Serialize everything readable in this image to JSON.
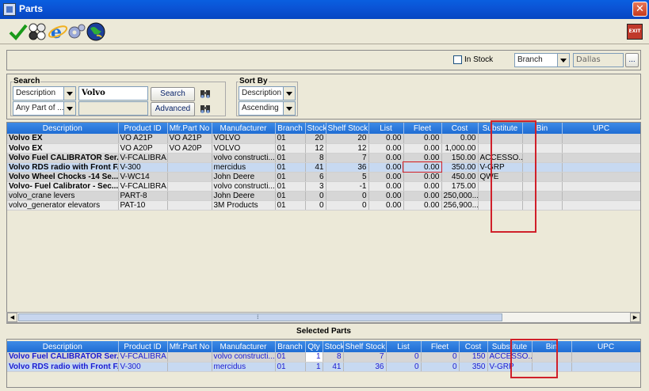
{
  "window": {
    "title": "Parts",
    "close_glyph": "✕"
  },
  "toolbar": {
    "icons": [
      "checkmark-icon",
      "parts-balls-icon",
      "internet-explorer-icon",
      "gears-icon",
      "globe-icon"
    ],
    "exit_label": "EXIT"
  },
  "filter": {
    "in_stock_label": "In Stock",
    "in_stock_checked": false,
    "branch_mode": "Branch",
    "branch_value": "Dallas",
    "browse_label": "..."
  },
  "search": {
    "group_title": "Search",
    "field_select": "Description",
    "query": "Volvo",
    "match_select": "Any Part of ...",
    "search_button": "Search",
    "advanced_button": "Advanced"
  },
  "sort": {
    "group_title": "Sort By",
    "field": "Description",
    "order": "Ascending"
  },
  "parts_table": {
    "columns": [
      "Description",
      "Product ID",
      "Mfr.Part No",
      "Manufacturer",
      "Branch",
      "Stock",
      "Shelf Stock",
      "List",
      "Fleet",
      "Cost",
      "Substitute",
      "Bin",
      "UPC"
    ],
    "rows": [
      [
        "Volvo EX",
        "VO A21P",
        "VO A21P",
        "VOLVO",
        "01",
        "20",
        "20",
        "0.00",
        "0.00",
        "0.00",
        "",
        "",
        ""
      ],
      [
        "Volvo EX",
        "VO A20P",
        "VO A20P",
        "VOLVO",
        "01",
        "12",
        "12",
        "0.00",
        "0.00",
        "1,000.00",
        "",
        "",
        ""
      ],
      [
        "Volvo Fuel CALIBRATOR Ser...",
        "V-FCALIBRA...",
        "",
        "volvo constructi...",
        "01",
        "8",
        "7",
        "0.00",
        "0.00",
        "150.00",
        "ACCESSO...",
        "",
        ""
      ],
      [
        "Volvo RDS radio with Front F...",
        "V-300",
        "",
        "mercidus",
        "01",
        "41",
        "36",
        "0.00",
        "0.00",
        "350.00",
        "V-GRP",
        "",
        ""
      ],
      [
        "Volvo Wheel Chocks -14 Se...",
        "V-WC14",
        "",
        "John Deere",
        "01",
        "6",
        "5",
        "0.00",
        "0.00",
        "450.00",
        "QWE",
        "",
        ""
      ],
      [
        "Volvo- Fuel Calibrator - Sec...",
        "V-FCALIBRA...",
        "",
        "volvo constructi...",
        "01",
        "3",
        "-1",
        "0.00",
        "0.00",
        "175.00",
        "",
        "",
        ""
      ],
      [
        "volvo_crane levers",
        "PART-8",
        "",
        "John Deere",
        "01",
        "0",
        "0",
        "0.00",
        "0.00",
        "250,000...",
        "",
        "",
        ""
      ],
      [
        "volvo_generator elevators",
        "PAT-10",
        "",
        "3M Products",
        "01",
        "0",
        "0",
        "0.00",
        "0.00",
        "256,900...",
        "",
        "",
        ""
      ]
    ],
    "bold_rows": [
      0,
      1,
      2,
      3,
      4,
      5
    ],
    "selected_row": 3
  },
  "selected": {
    "title": "Selected Parts",
    "columns": [
      "Description",
      "Product ID",
      "Mfr.Part No",
      "Manufacturer",
      "Branch",
      "Qty",
      "Stock",
      "Shelf Stock",
      "List",
      "Fleet",
      "Cost",
      "Substitute",
      "Bin",
      "UPC"
    ],
    "rows": [
      [
        "Volvo Fuel CALIBRATOR Ser...",
        "V-FCALIBRA...",
        "",
        "volvo constructi...",
        "01",
        "1",
        "8",
        "7",
        "0",
        "0",
        "150",
        "ACCESSO...",
        "",
        ""
      ],
      [
        "Volvo RDS radio with Front F...",
        "V-300",
        "",
        "mercidus",
        "01",
        "1",
        "41",
        "36",
        "0",
        "0",
        "350",
        "V-GRP",
        "",
        ""
      ]
    ]
  },
  "scroll": {
    "left": "◀",
    "right": "▶",
    "grip": "⁞"
  }
}
